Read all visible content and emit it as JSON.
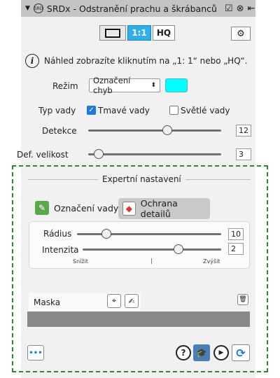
{
  "window": {
    "title": "SRDx - Odstranění prachu a škrábanců"
  },
  "preview": {
    "btn_frame": "",
    "btn_11": "1:1",
    "btn_hq": "HQ",
    "info_text": "Náhled zobrazíte kliknutím na „1: 1“ nebo „HQ“."
  },
  "mode": {
    "label": "Režim",
    "selected": "Označení chyb",
    "color": "#00ffff"
  },
  "defect_type": {
    "label": "Typ vady",
    "dark": "Tmavé vady",
    "light": "Světlé vady",
    "dark_checked": true,
    "light_checked": false
  },
  "detection": {
    "label": "Detekce",
    "value": "12",
    "level": 0.57
  },
  "def_size": {
    "label": "Def. velikost",
    "value": "3",
    "level": 0.08
  },
  "expert": {
    "header": "Expertní nastavení",
    "tabs": [
      {
        "label": "Označení vady",
        "active": false
      },
      {
        "label": "Ochrana detailů",
        "active": true
      }
    ],
    "radius": {
      "label": "Rádius",
      "value": "10",
      "level": 0.2
    },
    "intensity": {
      "label": "Intenzita",
      "value": "2",
      "level": 0.68
    },
    "scale": {
      "left": "Snížit",
      "mid": "|",
      "right": "Zvýšit"
    },
    "mask": {
      "label": "Maska"
    }
  },
  "bottom": {
    "more": "•••"
  }
}
